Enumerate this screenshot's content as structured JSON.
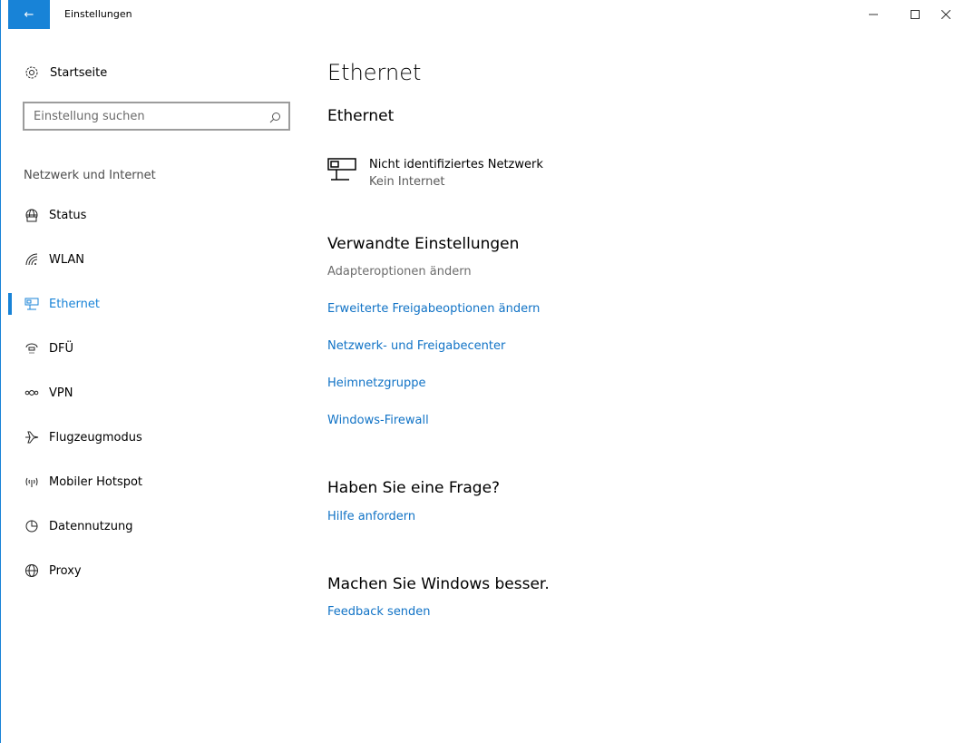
{
  "titlebar": {
    "back_glyph": "←",
    "title": "Einstellungen",
    "minimize_glyph": "—",
    "maximize_glyph": "☐",
    "close_glyph": "✕"
  },
  "sidebar": {
    "home_label": "Startseite",
    "search_placeholder": "Einstellung suchen",
    "section_label": "Netzwerk und Internet",
    "items": [
      {
        "label": "Status",
        "icon": "globe-status-icon"
      },
      {
        "label": "WLAN",
        "icon": "wifi-icon"
      },
      {
        "label": "Ethernet",
        "icon": "ethernet-icon",
        "active": true
      },
      {
        "label": "DFÜ",
        "icon": "dialup-icon"
      },
      {
        "label": "VPN",
        "icon": "vpn-icon"
      },
      {
        "label": "Flugzeugmodus",
        "icon": "airplane-icon"
      },
      {
        "label": "Mobiler Hotspot",
        "icon": "hotspot-icon"
      },
      {
        "label": "Datennutzung",
        "icon": "data-usage-icon"
      },
      {
        "label": "Proxy",
        "icon": "globe-icon"
      }
    ]
  },
  "main": {
    "page_title": "Ethernet",
    "section_title": "Ethernet",
    "network": {
      "name": "Nicht identifiziertes Netzwerk",
      "status": "Kein Internet"
    },
    "related": {
      "title": "Verwandte Einstellungen",
      "disabled_link": "Adapteroptionen ändern",
      "links": [
        "Erweiterte Freigabeoptionen ändern",
        "Netzwerk- und Freigabecenter",
        "Heimnetzgruppe",
        "Windows-Firewall"
      ]
    },
    "question": {
      "title": "Haben Sie eine Frage?",
      "link": "Hilfe anfordern"
    },
    "feedback": {
      "title": "Machen Sie Windows besser.",
      "link": "Feedback senden"
    }
  },
  "colors": {
    "accent": "#1883d7",
    "link": "#1173c6"
  }
}
